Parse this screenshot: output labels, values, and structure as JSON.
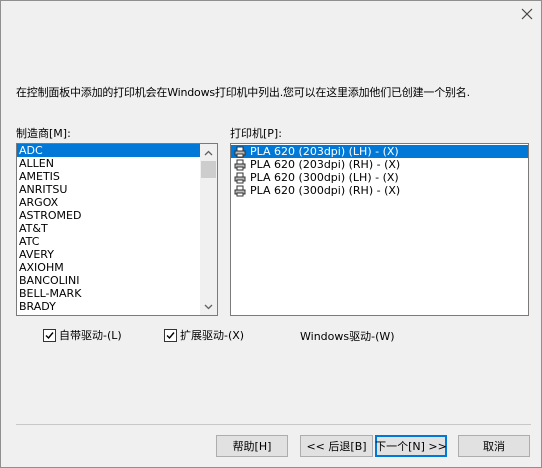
{
  "dialog": {
    "description": "在控制面板中添加的打印机会在Windows打印机中列出.您可以在这里添加他们已创建一个别名."
  },
  "manufacturers": {
    "label": "制造商[M]:",
    "items": [
      "ADC",
      "ALLEN",
      "AMETIS",
      "ANRITSU",
      "ARGOX",
      "ASTROMED",
      "AT&T",
      "ATC",
      "AVERY",
      "AXIOHM",
      "BANCOLINI",
      "BELL-MARK",
      "BRADY"
    ],
    "selected": "ADC"
  },
  "printers": {
    "label": "打印机[P]:",
    "items": [
      "PLA 620 (203dpi) (LH) - (X)",
      "PLA 620 (203dpi) (RH) - (X)",
      "PLA 620 (300dpi) (LH) - (X)",
      "PLA 620 (300dpi) (RH) - (X)"
    ],
    "selected": "PLA 620 (203dpi) (LH) - (X)"
  },
  "options": {
    "builtin_label": "自带驱动-(L)",
    "builtin_checked": true,
    "extended_label": "扩展驱动-(X)",
    "extended_checked": true,
    "windows_label": "Windows驱动-(W)"
  },
  "buttons": {
    "help": "帮助[H]",
    "back": "<< 后退[B]",
    "next": "下一个[N] >>",
    "cancel": "取消"
  },
  "colors": {
    "selection": "#0078d7",
    "dialog_bg": "#f0f0f0"
  }
}
